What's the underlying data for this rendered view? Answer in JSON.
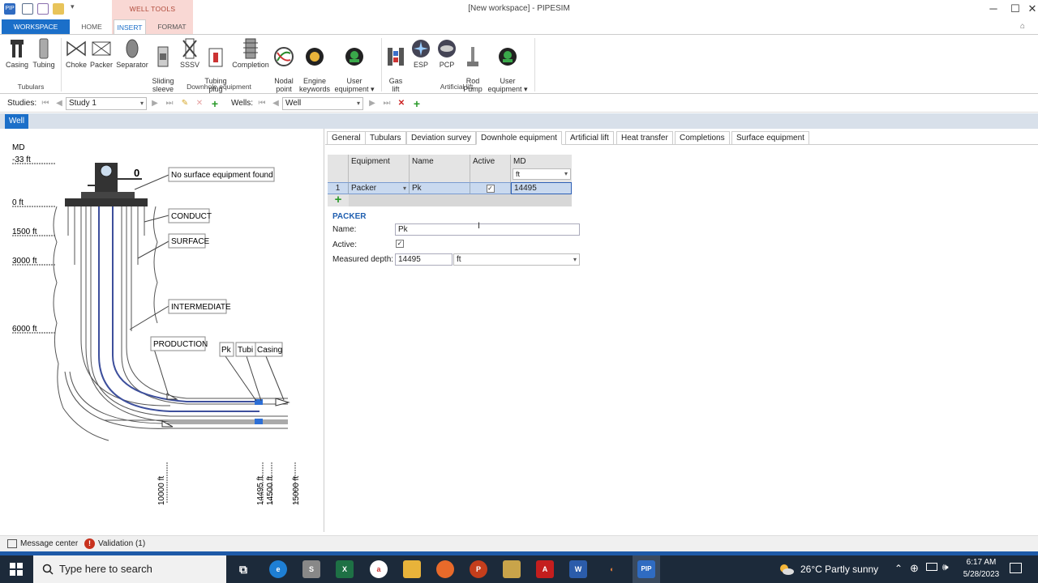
{
  "window": {
    "title": "[New workspace] - PIPESIM",
    "contextual_tab": "WELL TOOLS",
    "min_label": "─",
    "max_label": "☐",
    "close_label": "✕"
  },
  "ribbon_tabs": [
    "WORKSPACE",
    "HOME",
    "INSERT",
    "FORMAT"
  ],
  "ribbon": {
    "tubulars": {
      "group": "Tubulars",
      "items": [
        "Casing",
        "Tubing"
      ]
    },
    "downhole": {
      "group": "Downhole equipment",
      "items": [
        "Choke",
        "Packer",
        "Separator",
        "Sliding\nsleeve",
        "SSSV",
        "Tubing\nplug",
        "Completion",
        "Nodal\npoint",
        "Engine\nkeywords",
        "User\nequipment ▾"
      ]
    },
    "artificial": {
      "group": "Artificial lift",
      "items": [
        "Gas\nlift",
        "ESP",
        "PCP",
        "Rod\nPump",
        "User\nequipment ▾"
      ]
    }
  },
  "toolbar": {
    "studies_label": "Studies:",
    "study_value": "Study 1",
    "wells_label": "Wells:",
    "well_value": "Well"
  },
  "doc_tab": "Well",
  "schematic": {
    "md_label": "MD",
    "depth_labels": [
      "-33 ft",
      "0 ft",
      "1500 ft",
      "3000 ft",
      "6000 ft"
    ],
    "callouts": [
      "No surface equipment found",
      "CONDUCT",
      "SURFACE",
      "INTERMEDIATE",
      "PRODUCTION",
      "Pk",
      "Tubi",
      "Casing"
    ],
    "bottom_depths": [
      "10000 ft",
      "14495 ft",
      "14500 ft",
      "15000 ft"
    ],
    "gauge_value": "0"
  },
  "panel_tabs": [
    "General",
    "Tubulars",
    "Deviation survey",
    "Downhole equipment",
    "Artificial lift",
    "Heat transfer",
    "Completions",
    "Surface equipment"
  ],
  "active_panel_tab": "Downhole equipment",
  "grid": {
    "columns": [
      "Equipment",
      "Name",
      "Active",
      "MD"
    ],
    "md_unit": "ft",
    "rows": [
      {
        "num": "1",
        "equipment": "Packer",
        "name": "Pk",
        "active": "✓",
        "md": "14495"
      }
    ],
    "add_symbol": "+"
  },
  "packer_form": {
    "header": "PACKER",
    "name_label": "Name:",
    "name_value": "Pk",
    "active_label": "Active:",
    "active_check": "✓",
    "md_label": "Measured depth:",
    "md_value": "14495",
    "md_unit": "ft"
  },
  "statusbar": {
    "message_center": "Message center",
    "validation": "Validation (1)"
  },
  "taskbar": {
    "search_placeholder": "Type here to search",
    "weather": "26°C  Partly sunny",
    "time": "6:17 AM",
    "date": "5/28/2023"
  },
  "colors": {
    "accent": "#1b6fc9",
    "contextual": "#f9d8d4",
    "taskbar": "#1c2a3a"
  }
}
